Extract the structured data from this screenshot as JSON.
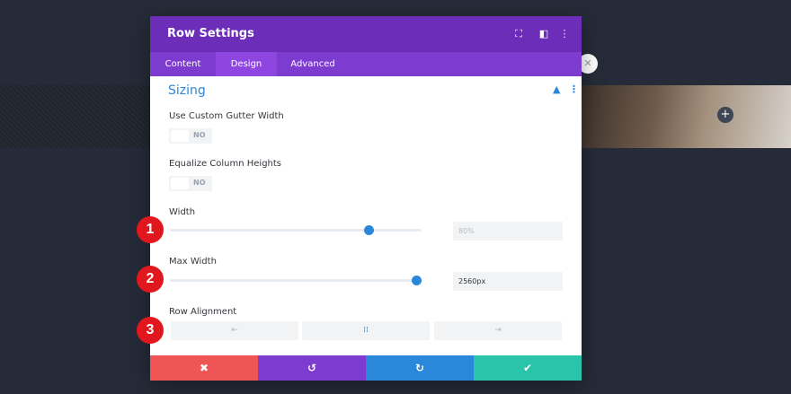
{
  "modal": {
    "title": "Row Settings",
    "tabs": [
      {
        "label": "Content"
      },
      {
        "label": "Design"
      },
      {
        "label": "Advanced"
      }
    ],
    "section_title": "Sizing",
    "fields": {
      "gutter": {
        "label": "Use Custom Gutter Width",
        "toggle": "NO"
      },
      "equalize": {
        "label": "Equalize Column Heights",
        "toggle": "NO"
      },
      "width": {
        "label": "Width",
        "placeholder": "80%",
        "slider_fraction": 0.79
      },
      "max_width": {
        "label": "Max Width",
        "value": "2560px",
        "slider_fraction": 0.98
      },
      "alignment": {
        "label": "Row Alignment",
        "options": [
          "left",
          "center",
          "right"
        ],
        "selected": "center"
      }
    },
    "footer": {
      "cancel_icon": "✖",
      "undo_icon": "↺",
      "redo_icon": "↻",
      "save_icon": "✔"
    }
  },
  "colors": {
    "header": "#6c2eb9",
    "tabs": "#7d3bcf",
    "tab_active": "#8f46e0",
    "accent": "#2b87da",
    "cancel": "#ef5555",
    "undo": "#7d3bcf",
    "redo": "#2b87da",
    "save": "#29c4a9",
    "marker": "#e0171d"
  },
  "markers": [
    "1",
    "2",
    "3"
  ]
}
